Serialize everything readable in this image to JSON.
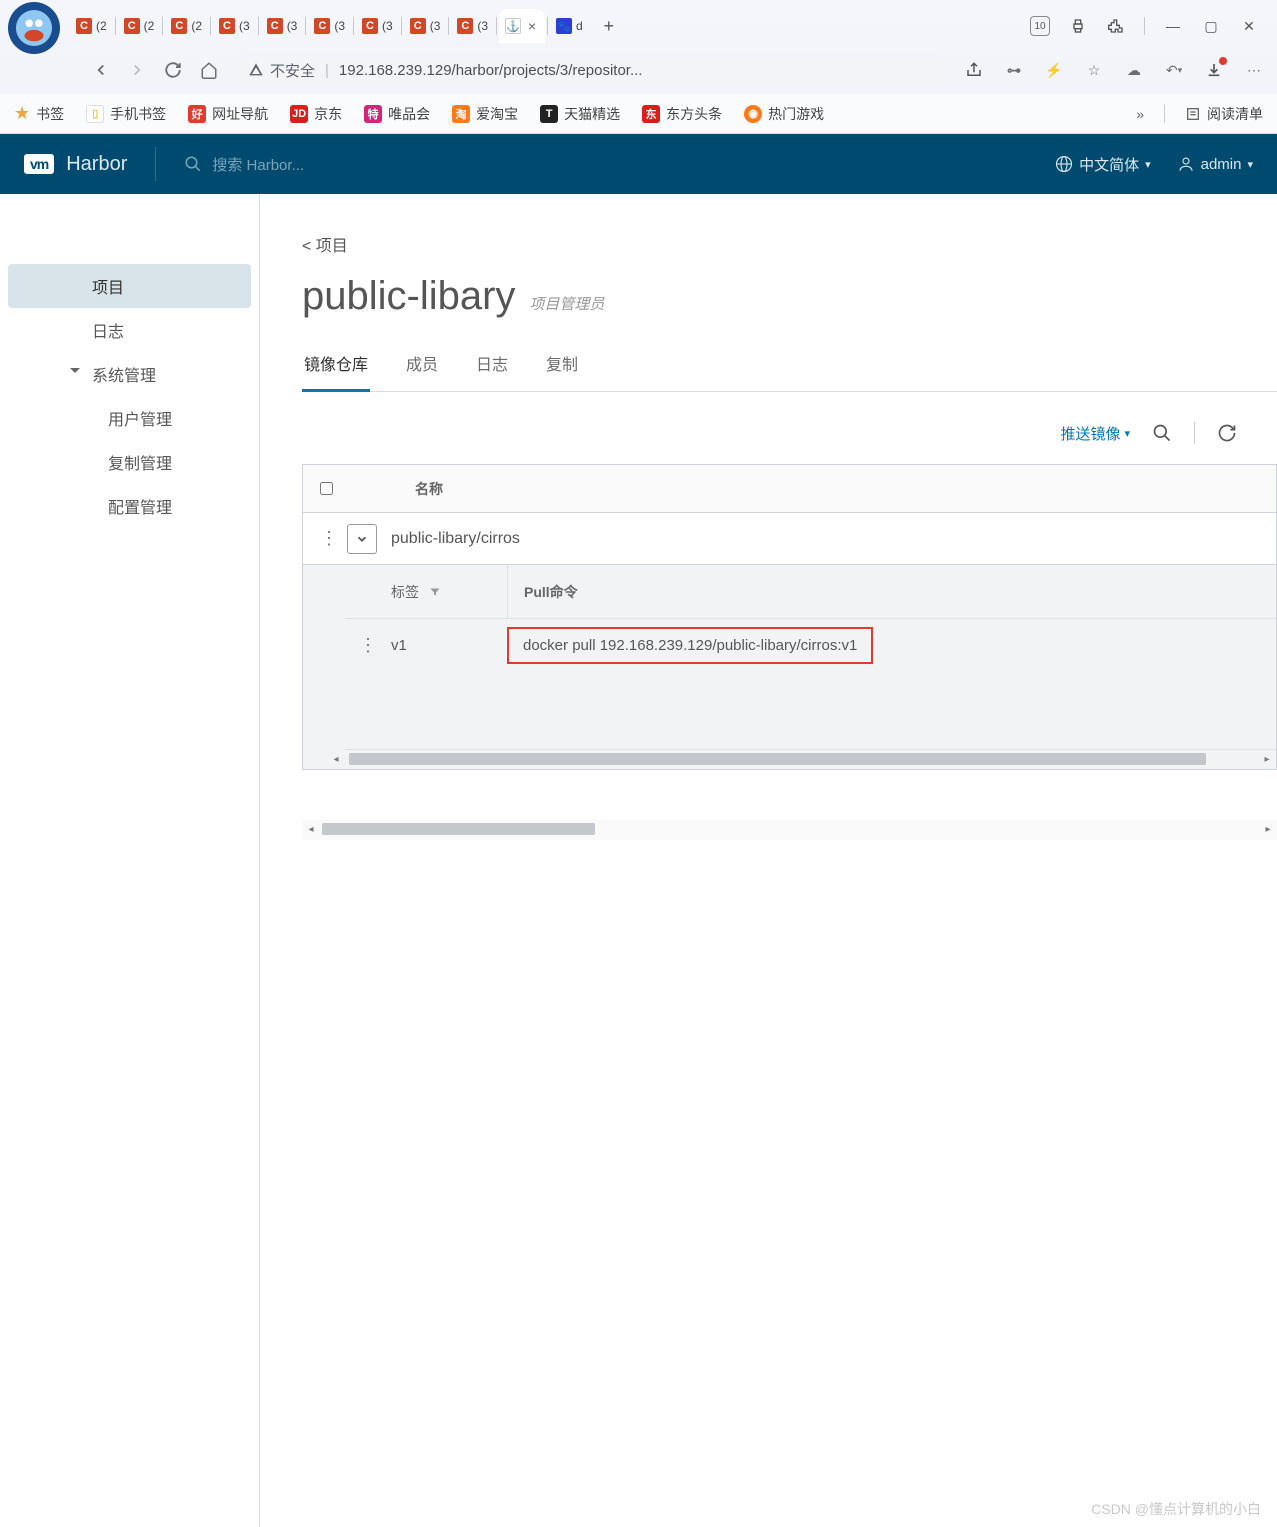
{
  "browser": {
    "tabs_generic_label": "(",
    "tabs": [
      {
        "icon": "C",
        "label": "(2"
      },
      {
        "icon": "C",
        "label": "(2"
      },
      {
        "icon": "C",
        "label": "(2"
      },
      {
        "icon": "C",
        "label": "(3"
      },
      {
        "icon": "C",
        "label": "(3"
      },
      {
        "icon": "C",
        "label": "(3"
      },
      {
        "icon": "C",
        "label": "(3"
      },
      {
        "icon": "C",
        "label": "(3"
      },
      {
        "icon": "C",
        "label": "(3"
      }
    ],
    "active_tab": {
      "icon": "harbor",
      "label": ""
    },
    "extra_tab": {
      "icon": "baidu",
      "label": "d"
    },
    "new_tab": "+",
    "window_count": "10",
    "address": {
      "warning_label": "不安全",
      "url": "192.168.239.129/harbor/projects/3/repositor..."
    },
    "bookmarks": [
      {
        "icon": "★",
        "color": "#f2a73b",
        "label": "书签"
      },
      {
        "icon": "□",
        "color": "#f2c44b",
        "label": "手机书签"
      },
      {
        "icon": "好",
        "color": "#e13b2e",
        "label": "网址导航"
      },
      {
        "icon": "JD",
        "color": "#d8201a",
        "label": "京东"
      },
      {
        "icon": "特",
        "color": "#d4237a",
        "label": "唯品会"
      },
      {
        "icon": "淘",
        "color": "#ff7a1a",
        "label": "爱淘宝"
      },
      {
        "icon": "T",
        "color": "#222",
        "label": "天猫精选"
      },
      {
        "icon": "东",
        "color": "#d8201a",
        "label": "东方头条"
      },
      {
        "icon": "◎",
        "color": "#ff7a1a",
        "label": "热门游戏"
      }
    ],
    "reading_list": "阅读清单"
  },
  "harbor": {
    "brand": "Harbor",
    "vm_logo": "vm",
    "search_placeholder": "搜索 Harbor...",
    "lang": "中文简体",
    "user": "admin",
    "sidebar": {
      "items": [
        {
          "label": "项目",
          "selected": true
        },
        {
          "label": "日志"
        },
        {
          "label": "系统管理",
          "parent": true
        },
        {
          "label": "用户管理",
          "lvl2": true
        },
        {
          "label": "复制管理",
          "lvl2": true
        },
        {
          "label": "配置管理",
          "lvl2": true
        }
      ]
    },
    "crumb": "< 项目",
    "project_name": "public-libary",
    "project_role": "项目管理员",
    "tabs": [
      {
        "label": "镜像仓库",
        "active": true
      },
      {
        "label": "成员"
      },
      {
        "label": "日志"
      },
      {
        "label": "复制"
      }
    ],
    "push_image": "推送镜像",
    "table": {
      "name_header": "名称",
      "repo_name": "public-libary/cirros",
      "sub_headers": {
        "tag": "标签",
        "pull": "Pull命令"
      },
      "row": {
        "tag": "v1",
        "pull": "docker pull 192.168.239.129/public-libary/cirros:v1"
      }
    }
  },
  "watermark": "CSDN @懂点计算机的小白"
}
